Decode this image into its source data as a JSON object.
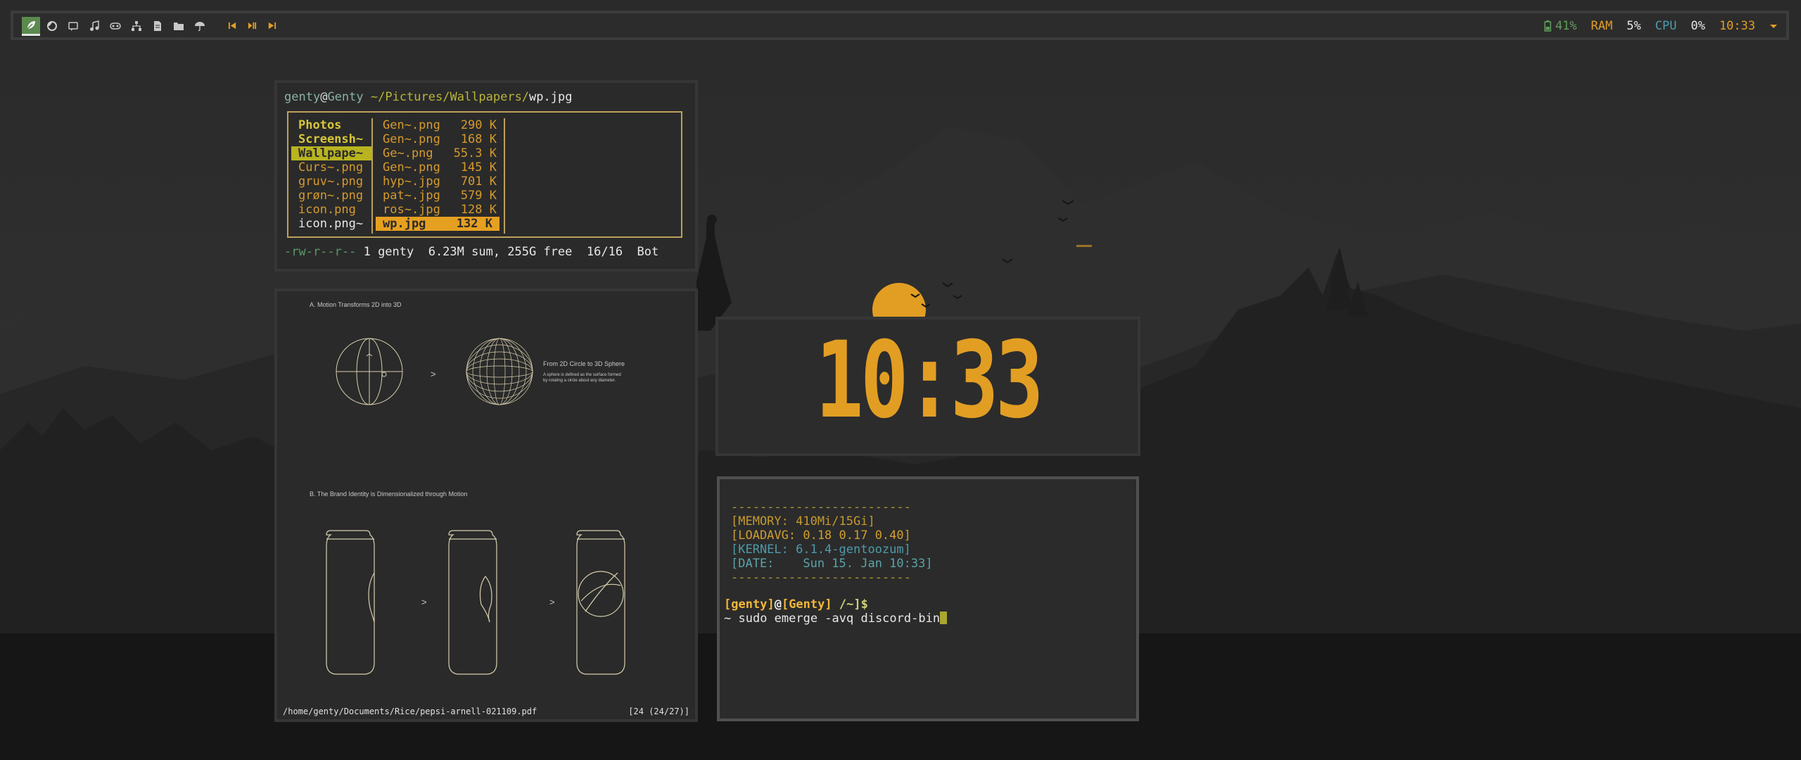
{
  "bar": {
    "workspaces": [
      {
        "name": "leaf-icon",
        "active": true
      },
      {
        "name": "firefox-icon",
        "active": false
      },
      {
        "name": "chat-icon",
        "active": false
      },
      {
        "name": "music-icon",
        "active": false
      },
      {
        "name": "gamepad-icon",
        "active": false
      },
      {
        "name": "network-icon",
        "active": false
      },
      {
        "name": "document-icon",
        "active": false
      },
      {
        "name": "folder-icon",
        "active": false
      },
      {
        "name": "umbrella-icon",
        "active": false
      }
    ],
    "media": [
      "previous-icon",
      "play-pause-icon",
      "next-icon"
    ],
    "status": {
      "battery": "41%",
      "ram_label": "RAM",
      "ram_value": "5%",
      "cpu_label": "CPU",
      "cpu_value": "0%",
      "time": "10:33"
    },
    "colors": {
      "green": "#5fa05a",
      "amber": "#e29e23",
      "teal": "#4d9bab"
    }
  },
  "file_manager": {
    "user": "genty",
    "host": "Genty",
    "path": "~/Pictures/Wallpapers/",
    "file": "wp.jpg",
    "parent": [
      {
        "label": "Photos",
        "kind": "dir",
        "selected": false
      },
      {
        "label": "Screensh~",
        "kind": "dir",
        "selected": false
      },
      {
        "label": "Wallpape~",
        "kind": "dir",
        "selected": true
      },
      {
        "label": "Curs~.png",
        "kind": "img",
        "selected": false
      },
      {
        "label": "gruv~.png",
        "kind": "img",
        "selected": false
      },
      {
        "label": "grøn~.png",
        "kind": "img",
        "selected": false
      },
      {
        "label": "icon.png",
        "kind": "img",
        "selected": false
      },
      {
        "label": "icon.png~",
        "kind": "plain",
        "selected": false
      }
    ],
    "current": [
      {
        "name": "Gen~.png",
        "size": "290 K",
        "selected": false
      },
      {
        "name": "Gen~.png",
        "size": "168 K",
        "selected": false
      },
      {
        "name": "Ge~.png",
        "size": "55.3 K",
        "selected": false
      },
      {
        "name": "Gen~.png",
        "size": "145 K",
        "selected": false
      },
      {
        "name": "hyp~.jpg",
        "size": "701 K",
        "selected": false
      },
      {
        "name": "pat~.jpg",
        "size": "579 K",
        "selected": false
      },
      {
        "name": "ros~.jpg",
        "size": "128 K",
        "selected": false
      },
      {
        "name": "wp.jpg",
        "size": "132 K",
        "selected": true
      }
    ],
    "footer": {
      "perm": "-rw-r--r--",
      "info": " 1 genty  6.23M sum, 255G free  16/16  Bot"
    }
  },
  "pdf": {
    "section_a": "A. Motion Transforms 2D into 3D",
    "arrow": ">",
    "sphere_title": "From 2D Circle to 3D Sphere",
    "sphere_desc_1": "A sphere is defined as the surface formed",
    "sphere_desc_2": "by rotating a circle about any diameter.",
    "section_b": "B. The Brand Identity is Dimensionalized through Motion",
    "path": "/home/genty/Documents/Rice/pepsi-arnell-021109.pdf",
    "page": "[24 (24/27)]"
  },
  "clock": {
    "time": "10:33",
    "color": "#e29e23"
  },
  "terminal": {
    "sep": "-------------------------",
    "memory": "[MEMORY: 410Mi/15Gi]",
    "loadavg": "[LOADAVG: 0.18 0.17 0.40]",
    "kernel": "[KERNEL: 6.1.4-gentoozum]",
    "date": "[DATE:    Sun 15. Jan 10:33]",
    "prompt_user": "genty",
    "prompt_host": "Genty",
    "prompt_dir": "~",
    "command_prefix": "~ ",
    "command": "sudo emerge -avq discord-bin"
  }
}
